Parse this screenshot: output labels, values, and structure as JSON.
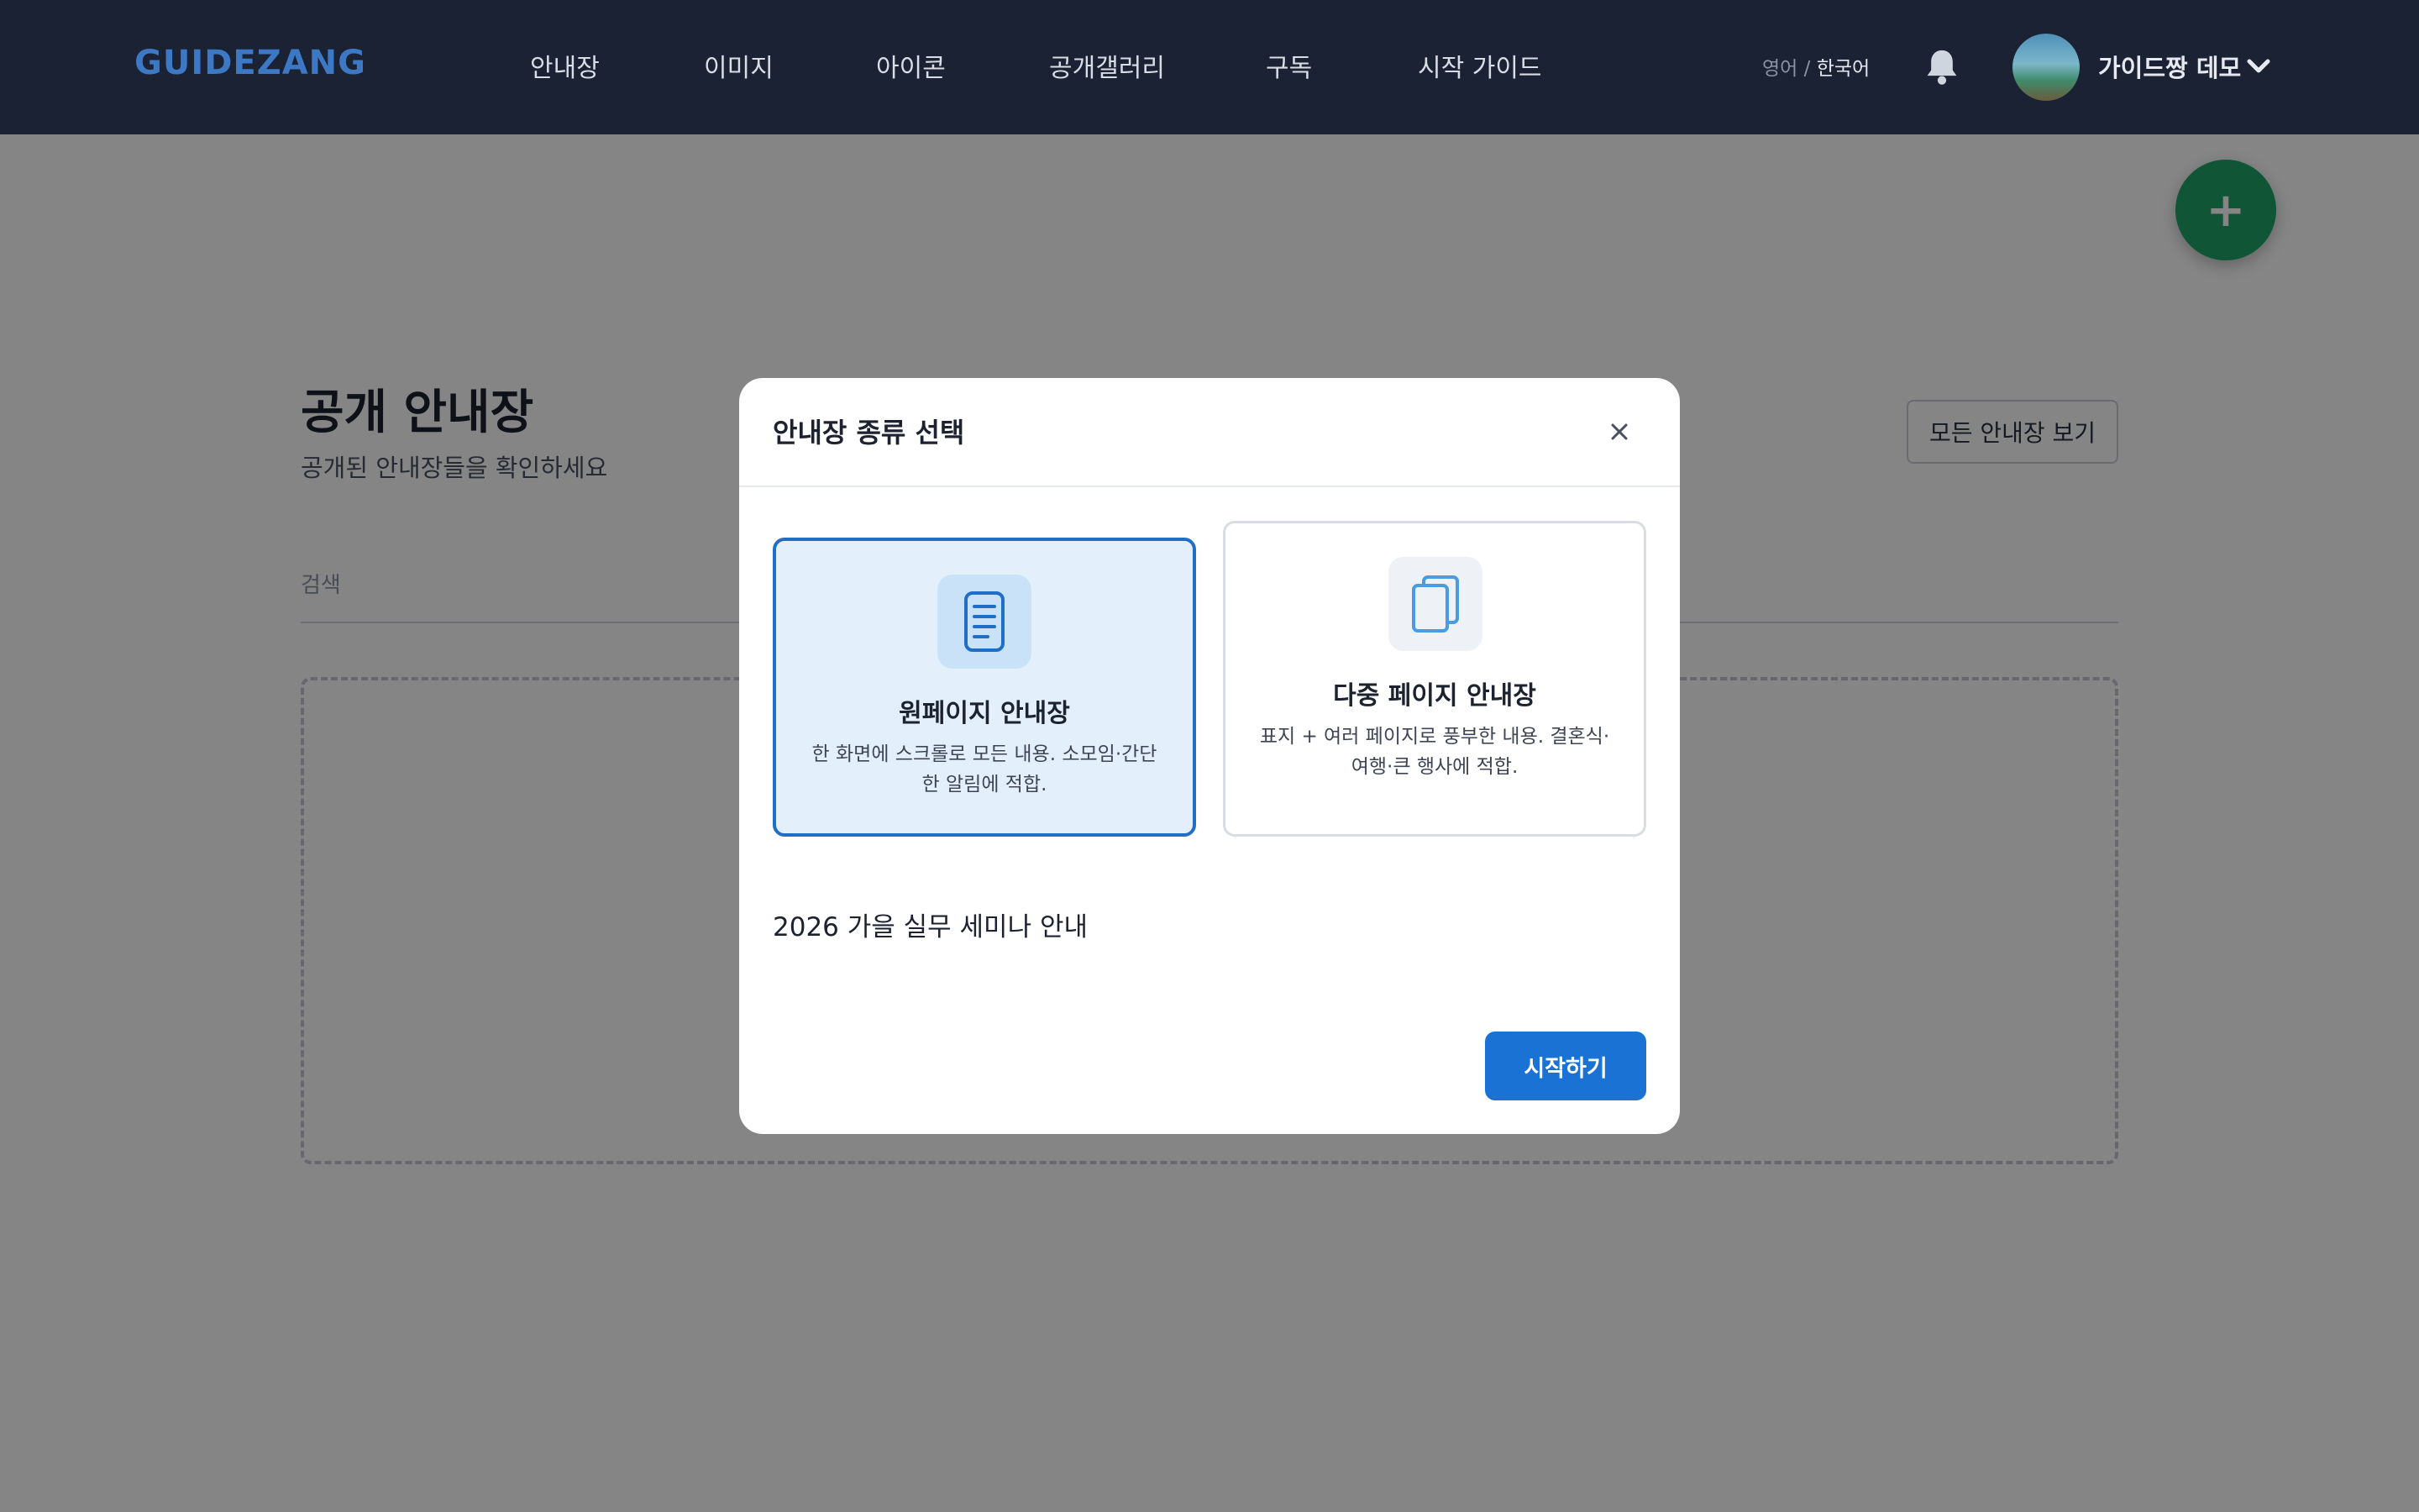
{
  "header": {
    "logo": "GUIDEZANG",
    "nav": [
      "안내장",
      "이미지",
      "아이콘",
      "공개갤러리",
      "구독",
      "시작 가이드"
    ],
    "lang_inactive": "영어",
    "lang_sep": " / ",
    "lang_active": "한국어",
    "user_name": "가이드짱 데모"
  },
  "page": {
    "title": "공개 안내장",
    "subtitle": "공개된 안내장들을 확인하세요",
    "view_all": "모든 안내장 보기",
    "search_label": "검색",
    "fab_label": "+"
  },
  "modal": {
    "title": "안내장 종류 선택",
    "options": [
      {
        "title": "원페이지 안내장",
        "desc": "한 화면에 스크롤로 모든 내용. 소모임·간단한 알림에 적합.",
        "selected": true
      },
      {
        "title": "다중 페이지 안내장",
        "desc": "표지 + 여러 페이지로 풍부한 내용. 결혼식·여행·큰 행사에 적합.",
        "selected": false
      }
    ],
    "name_value": "2026 가을 실무 세미나 안내",
    "start_button": "시작하기"
  },
  "colors": {
    "header_bg": "#1b2233",
    "logo": "#3d78c4",
    "accent": "#1a73d4",
    "fab": "#22a36a",
    "selected_bg": "#e3f0fc",
    "selected_border": "#1e6fc5"
  },
  "icons": {
    "bell": "bell-icon",
    "chevron": "chevron-down-icon",
    "close": "close-icon",
    "onepage": "document-icon",
    "multipage": "pages-icon"
  }
}
